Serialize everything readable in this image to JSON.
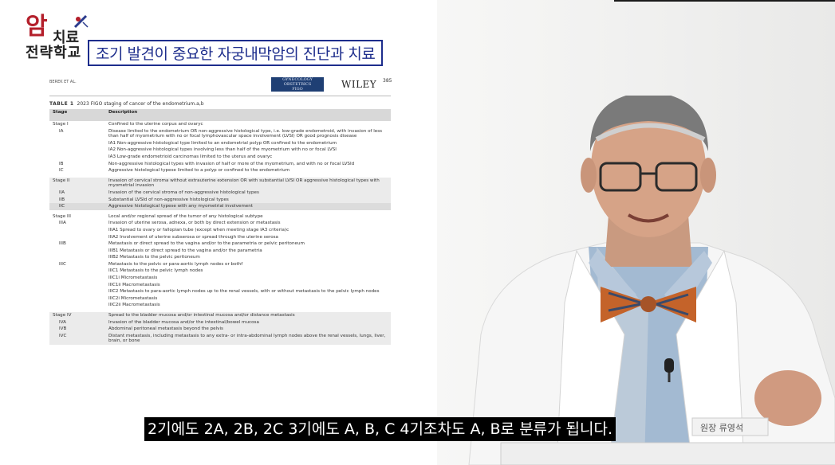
{
  "logo": {
    "big": "암",
    "line1": "치료",
    "line2": "전략학교"
  },
  "title": "조기 발견이 중요한 자궁내막암의 진단과 치료",
  "doc": {
    "author": "BEREK ET AL.",
    "journal_line1": "GYNECOLOGY",
    "journal_line2": "OBSTETRICS",
    "journal_line3": "FIGO",
    "publisher": "WILEY",
    "page": "385",
    "caption_label": "TABLE 1",
    "caption_text": "2023 FIGO staging of cancer of the endometrium.a,b",
    "col_stage": "Stage",
    "col_desc": "Description",
    "rows": [
      {
        "s": "Stage I",
        "d": "Confined to the uterine corpus and ovaryc"
      },
      {
        "s": "IA",
        "d": "Disease limited to the endometrium OR non-aggressive histological type, i.e. low-grade endometroid, with invasion of less than half of myometrium with no or focal lymphovascular space involvement (LVSI) OR good prognosis disease"
      },
      {
        "s": "",
        "d": "IA1 Non-aggressive histological type limited to an endometrial polyp OR confined to the endometrium"
      },
      {
        "s": "",
        "d": "IA2 Non-aggressive histological types involving less than half of the myometrium with no or focal LVSI"
      },
      {
        "s": "",
        "d": "IA3 Low-grade endometrioid carcinomas limited to the uterus and ovaryc"
      },
      {
        "s": "IB",
        "d": "Non-aggressive histological types with invasion of half or more of the myometrium, and with no or focal LVSId"
      },
      {
        "s": "IC",
        "d": "Aggressive histological typese limited to a polyp or confined to the endometrium"
      },
      {
        "s": "Stage II",
        "d": "Invasion of cervical stroma without extrauterine extension OR with substantial LVSI OR aggressive histological types with myometrial invasion"
      },
      {
        "s": "IIA",
        "d": "Invasion of the cervical stroma of non-aggressive histological types"
      },
      {
        "s": "IIB",
        "d": "Substantial LVSId of non-aggressive histological types"
      },
      {
        "s": "IIC",
        "d": "Aggressive histological typese with any myometrial involvement"
      },
      {
        "s": "Stage III",
        "d": "Local and/or regional spread of the tumor of any histological subtype"
      },
      {
        "s": "IIIA",
        "d": "Invasion of uterine serosa, adnexa, or both by direct extension or metastasis"
      },
      {
        "s": "",
        "d": "IIIA1 Spread to ovary or fallopian tube (except when meeting stage IA3 criteria)c"
      },
      {
        "s": "",
        "d": "IIIA2 Involvement of uterine subserosa or spread through the uterine serosa"
      },
      {
        "s": "IIIB",
        "d": "Metastasis or direct spread to the vagina and/or to the parametria or pelvic peritoneum"
      },
      {
        "s": "",
        "d": "IIIB1 Metastasis or direct spread to the vagina and/or the parametria"
      },
      {
        "s": "",
        "d": "IIIB2 Metastasis to the pelvic peritoneum"
      },
      {
        "s": "IIIC",
        "d": "Metastasis to the pelvic or para-aortic lymph nodes or bothf"
      },
      {
        "s": "",
        "d": "IIIC1 Metastasis to the pelvic lymph nodes"
      },
      {
        "s": "",
        "d": "IIIC1i Micrometastasis"
      },
      {
        "s": "",
        "d": "IIIC1ii Macrometastasis"
      },
      {
        "s": "",
        "d": "IIIC2 Metastasis to para-aortic lymph nodes up to the renal vessels, with or without metastasis to the pelvic lymph nodes"
      },
      {
        "s": "",
        "d": "IIIC2i Micrometastasis"
      },
      {
        "s": "",
        "d": "IIIC2ii Macrometastasis"
      },
      {
        "s": "Stage IV",
        "d": "Spread to the bladder mucosa and/or intestinal mucosa and/or distance metastasis"
      },
      {
        "s": "IVA",
        "d": "Invasion of the bladder mucosa and/or the intestinal/bowel mucosa"
      },
      {
        "s": "IVB",
        "d": "Abdominal peritoneal metastasis beyond the pelvis"
      },
      {
        "s": "IVC",
        "d": "Distant metastasis, including metastasis to any extra- or intra-abdominal lymph nodes above the renal vessels, lungs, liver, brain, or bone"
      }
    ]
  },
  "name_tag": "원장  류영석",
  "subtitle": "2기에도 2A, 2B, 2C 3기에도 A, B, C 4기조차도 A, B로 분류가 됩니다.",
  "colors": {
    "title": "#1d2d8c",
    "logo_red": "#b41f2b",
    "coat": "#ffffff",
    "shirt": "#9fb7d0"
  }
}
